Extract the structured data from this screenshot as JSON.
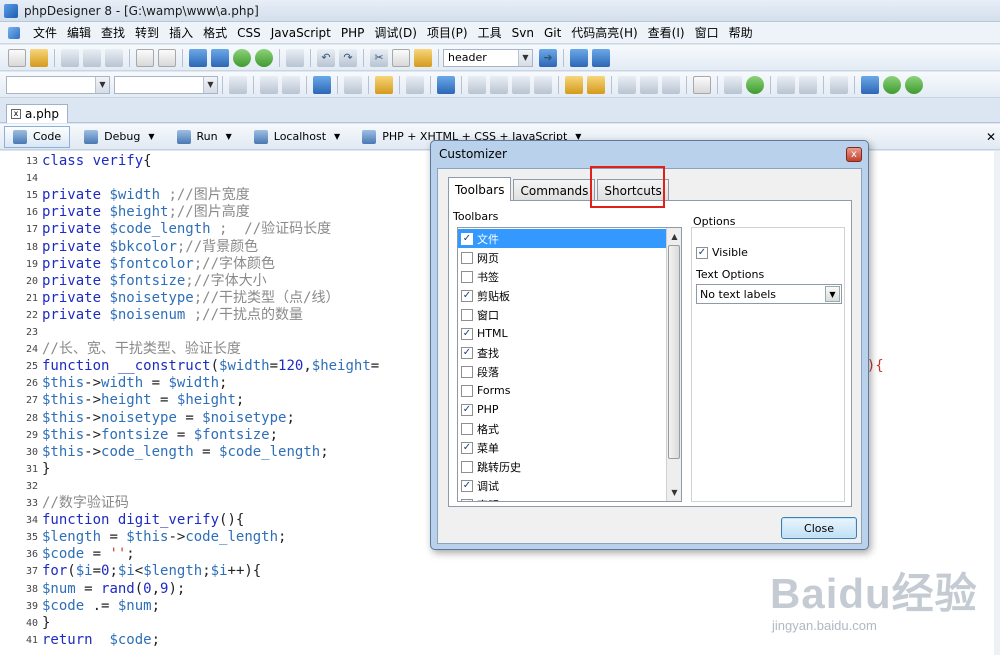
{
  "window": {
    "title": "phpDesigner 8 - [G:\\wamp\\www\\a.php]"
  },
  "menu": [
    "文件",
    "编辑",
    "查找",
    "转到",
    "插入",
    "格式",
    "CSS",
    "JavaScript",
    "PHP",
    "调试(D)",
    "项目(P)",
    "工具",
    "Svn",
    "Git",
    "代码高亮(H)",
    "查看(I)",
    "窗口",
    "帮助"
  ],
  "toolbar": {
    "search_value": "header"
  },
  "doc_tab": {
    "label": "a.php"
  },
  "modebar": {
    "code": "Code",
    "debug": "Debug",
    "run": "Run",
    "localhost": "Localhost",
    "language": "PHP + XHTML + CSS + JavaScript"
  },
  "code_lines": [
    {
      "n": "13",
      "parts": [
        [
          "kw",
          "class "
        ],
        [
          "fn",
          "verify"
        ],
        [
          "tx",
          "{"
        ]
      ]
    },
    {
      "n": "14",
      "parts": []
    },
    {
      "n": "15",
      "parts": [
        [
          "kw",
          "private "
        ],
        [
          "var",
          "$width "
        ],
        [
          "cm",
          ";//图片宽度"
        ]
      ]
    },
    {
      "n": "16",
      "parts": [
        [
          "kw",
          "private "
        ],
        [
          "var",
          "$height"
        ],
        [
          "cm",
          ";//图片高度"
        ]
      ]
    },
    {
      "n": "17",
      "parts": [
        [
          "kw",
          "private "
        ],
        [
          "var",
          "$code_length "
        ],
        [
          "cm",
          ";  //验证码长度"
        ]
      ]
    },
    {
      "n": "18",
      "parts": [
        [
          "kw",
          "private "
        ],
        [
          "var",
          "$bkcolor"
        ],
        [
          "cm",
          ";//背景颜色"
        ]
      ]
    },
    {
      "n": "19",
      "parts": [
        [
          "kw",
          "private "
        ],
        [
          "var",
          "$fontcolor"
        ],
        [
          "cm",
          ";//字体颜色"
        ]
      ]
    },
    {
      "n": "20",
      "parts": [
        [
          "kw",
          "private "
        ],
        [
          "var",
          "$fontsize"
        ],
        [
          "cm",
          ";//字体大小"
        ]
      ]
    },
    {
      "n": "21",
      "parts": [
        [
          "kw",
          "private "
        ],
        [
          "var",
          "$noisetype"
        ],
        [
          "cm",
          ";//干扰类型（点/线）"
        ]
      ]
    },
    {
      "n": "22",
      "parts": [
        [
          "kw",
          "private "
        ],
        [
          "var",
          "$noisenum "
        ],
        [
          "cm",
          ";//干扰点的数量"
        ]
      ]
    },
    {
      "n": "23",
      "parts": []
    },
    {
      "n": "24",
      "parts": [
        [
          "cm",
          "//长、宽、干扰类型、验证长度"
        ]
      ]
    },
    {
      "n": "25",
      "parts": [
        [
          "kw",
          "function "
        ],
        [
          "fn",
          "__construct"
        ],
        [
          "tx",
          "("
        ],
        [
          "var",
          "$width"
        ],
        [
          "tx",
          "="
        ],
        [
          "num",
          "120"
        ],
        [
          "tx",
          ","
        ],
        [
          "var",
          "$height"
        ],
        [
          "tx",
          "="
        ]
      ]
    },
    {
      "n": "26",
      "parts": [
        [
          "var",
          "$this"
        ],
        [
          "tx",
          "->"
        ],
        [
          "var",
          "width "
        ],
        [
          "tx",
          "= "
        ],
        [
          "var",
          "$width"
        ],
        [
          "tx",
          ";"
        ]
      ]
    },
    {
      "n": "27",
      "parts": [
        [
          "var",
          "$this"
        ],
        [
          "tx",
          "->"
        ],
        [
          "var",
          "height "
        ],
        [
          "tx",
          "= "
        ],
        [
          "var",
          "$height"
        ],
        [
          "tx",
          ";"
        ]
      ]
    },
    {
      "n": "28",
      "parts": [
        [
          "var",
          "$this"
        ],
        [
          "tx",
          "->"
        ],
        [
          "var",
          "noisetype "
        ],
        [
          "tx",
          "= "
        ],
        [
          "var",
          "$noisetype"
        ],
        [
          "tx",
          ";"
        ]
      ]
    },
    {
      "n": "29",
      "parts": [
        [
          "var",
          "$this"
        ],
        [
          "tx",
          "->"
        ],
        [
          "var",
          "fontsize "
        ],
        [
          "tx",
          "= "
        ],
        [
          "var",
          "$fontsize"
        ],
        [
          "tx",
          ";"
        ]
      ]
    },
    {
      "n": "30",
      "parts": [
        [
          "var",
          "$this"
        ],
        [
          "tx",
          "->"
        ],
        [
          "var",
          "code_length "
        ],
        [
          "tx",
          "= "
        ],
        [
          "var",
          "$code_length"
        ],
        [
          "tx",
          ";"
        ]
      ]
    },
    {
      "n": "31",
      "parts": [
        [
          "tx",
          "}"
        ]
      ]
    },
    {
      "n": "32",
      "parts": []
    },
    {
      "n": "33",
      "parts": [
        [
          "cm",
          "//数字验证码"
        ]
      ]
    },
    {
      "n": "34",
      "parts": [
        [
          "kw",
          "function "
        ],
        [
          "fn",
          "digit_verify"
        ],
        [
          "tx",
          "(){"
        ]
      ]
    },
    {
      "n": "35",
      "parts": [
        [
          "var",
          "$length "
        ],
        [
          "tx",
          "= "
        ],
        [
          "var",
          "$this"
        ],
        [
          "tx",
          "->"
        ],
        [
          "var",
          "code_length"
        ],
        [
          "tx",
          ";"
        ]
      ]
    },
    {
      "n": "36",
      "parts": [
        [
          "var",
          "$code "
        ],
        [
          "tx",
          "= "
        ],
        [
          "str",
          "''"
        ],
        [
          "tx",
          ";"
        ]
      ]
    },
    {
      "n": "37",
      "parts": [
        [
          "kw",
          "for"
        ],
        [
          "tx",
          "("
        ],
        [
          "var",
          "$i"
        ],
        [
          "tx",
          "="
        ],
        [
          "num",
          "0"
        ],
        [
          "tx",
          ";"
        ],
        [
          "var",
          "$i"
        ],
        [
          "tx",
          "<"
        ],
        [
          "var",
          "$length"
        ],
        [
          "tx",
          ";"
        ],
        [
          "var",
          "$i"
        ],
        [
          "tx",
          "++){"
        ]
      ]
    },
    {
      "n": "38",
      "parts": [
        [
          "var",
          "$num "
        ],
        [
          "tx",
          "= "
        ],
        [
          "fn",
          "rand"
        ],
        [
          "tx",
          "("
        ],
        [
          "num",
          "0"
        ],
        [
          "tx",
          ","
        ],
        [
          "num",
          "9"
        ],
        [
          "tx",
          ");"
        ]
      ]
    },
    {
      "n": "39",
      "parts": [
        [
          "var",
          "$code "
        ],
        [
          "tx",
          ".= "
        ],
        [
          "var",
          "$num"
        ],
        [
          "tx",
          ";"
        ]
      ]
    },
    {
      "n": "40",
      "parts": [
        [
          "tx",
          "}"
        ]
      ]
    },
    {
      "n": "41",
      "parts": [
        [
          "kw",
          "return  "
        ],
        [
          "var",
          "$code"
        ],
        [
          "tx",
          ";"
        ]
      ]
    }
  ],
  "line25_tail": "e'){",
  "dialog": {
    "title": "Customizer",
    "close_glyph": "x",
    "tabs": [
      "Toolbars",
      "Commands",
      "Shortcuts"
    ],
    "toolbars_label": "Toolbars",
    "toolbars": [
      {
        "label": "文件",
        "checked": true,
        "selected": true
      },
      {
        "label": "网页",
        "checked": false
      },
      {
        "label": "书签",
        "checked": false
      },
      {
        "label": "剪贴板",
        "checked": true
      },
      {
        "label": "窗口",
        "checked": false
      },
      {
        "label": "HTML",
        "checked": true
      },
      {
        "label": "查找",
        "checked": true
      },
      {
        "label": "段落",
        "checked": false
      },
      {
        "label": "Forms",
        "checked": false
      },
      {
        "label": "PHP",
        "checked": true
      },
      {
        "label": "格式",
        "checked": false
      },
      {
        "label": "菜单",
        "checked": true
      },
      {
        "label": "跳转历史",
        "checked": false
      },
      {
        "label": "调试",
        "checked": true
      },
      {
        "label": "声明",
        "checked": true
      }
    ],
    "options_label": "Options",
    "visible_label": "Visible",
    "visible_checked": true,
    "text_options_label": "Text Options",
    "text_options_value": "No text labels",
    "close_button": "Close"
  },
  "watermark": {
    "brand": "Baidu经验",
    "url": "jingyan.baidu.com"
  },
  "colors": {
    "highlight": "#e0201a",
    "selection": "#3399ff"
  }
}
